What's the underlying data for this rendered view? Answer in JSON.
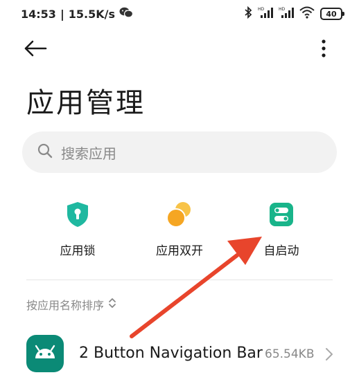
{
  "status_bar": {
    "time": "14:53",
    "speed": "15.5K/s",
    "battery": "40",
    "icons": [
      "wechat-icon",
      "bluetooth-icon",
      "signal-hd-icon",
      "signal-hd-icon",
      "wifi-icon",
      "battery-icon"
    ]
  },
  "header": {
    "back_icon": "arrow-left-icon",
    "more_icon": "more-vertical-icon",
    "title": "应用管理"
  },
  "search": {
    "placeholder": "搜索应用",
    "icon": "search-icon"
  },
  "features": [
    {
      "label": "应用锁",
      "icon": "app-lock-shield-icon",
      "color": "#1fb8a0"
    },
    {
      "label": "应用双开",
      "icon": "dual-apps-icon",
      "color": "#f5a623"
    },
    {
      "label": "自启动",
      "icon": "autostart-toggle-icon",
      "color": "#19b48a"
    }
  ],
  "sort": {
    "label": "按应用名称排序",
    "icon": "sort-chevron-icon"
  },
  "apps": [
    {
      "name": "2 Button Navigation Bar",
      "size": "65.54KB",
      "icon": "android-icon",
      "icon_color": "#0b8a76"
    }
  ],
  "annotation": {
    "arrow_color": "#e8452c"
  }
}
